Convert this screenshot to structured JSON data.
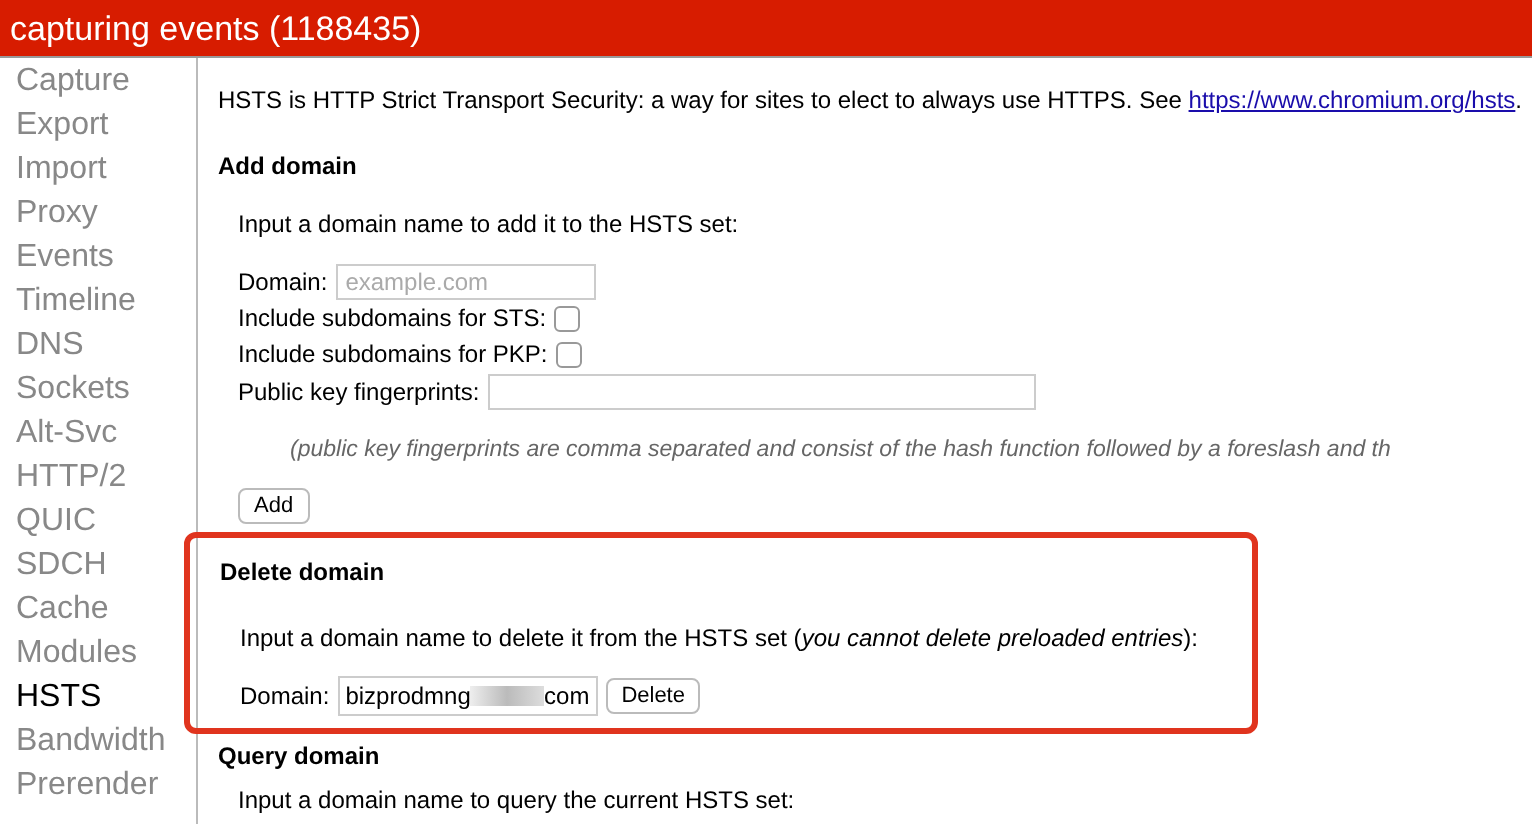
{
  "header": {
    "title": "capturing events (1188435)"
  },
  "sidebar": {
    "items": [
      {
        "label": "Capture",
        "selected": false
      },
      {
        "label": "Export",
        "selected": false
      },
      {
        "label": "Import",
        "selected": false
      },
      {
        "label": "Proxy",
        "selected": false
      },
      {
        "label": "Events",
        "selected": false
      },
      {
        "label": "Timeline",
        "selected": false
      },
      {
        "label": "DNS",
        "selected": false
      },
      {
        "label": "Sockets",
        "selected": false
      },
      {
        "label": "Alt-Svc",
        "selected": false
      },
      {
        "label": "HTTP/2",
        "selected": false
      },
      {
        "label": "QUIC",
        "selected": false
      },
      {
        "label": "SDCH",
        "selected": false
      },
      {
        "label": "Cache",
        "selected": false
      },
      {
        "label": "Modules",
        "selected": false
      },
      {
        "label": "HSTS",
        "selected": true
      },
      {
        "label": "Bandwidth",
        "selected": false
      },
      {
        "label": "Prerender",
        "selected": false
      }
    ]
  },
  "intro": {
    "text": "HSTS is HTTP Strict Transport Security: a way for sites to elect to always use HTTPS. See",
    "link": "https://www.chromium.org/hsts",
    "after": "."
  },
  "add_domain": {
    "heading": "Add domain",
    "instruction": "Input a domain name to add it to the HSTS set:",
    "domain_label": "Domain:",
    "domain_placeholder": "example.com",
    "sts_label": "Include subdomains for STS:",
    "sts_checked": false,
    "pkp_label": "Include subdomains for PKP:",
    "pkp_checked": false,
    "fingerprints_label": "Public key fingerprints:",
    "note": "(public key fingerprints are comma separated and consist of the hash function followed by a foreslash and th",
    "button": "Add"
  },
  "delete_domain": {
    "heading": "Delete domain",
    "instruction": "Input a domain name to delete it from the HSTS set (*you cannot delete preloaded entries*):",
    "domain_label": "Domain:",
    "domain_value_start": "bizprodmng",
    "domain_value_end": "com",
    "button": "Delete"
  },
  "query_domain": {
    "heading": "Query domain",
    "instruction": "Input a domain name to query the current HSTS set:"
  }
}
